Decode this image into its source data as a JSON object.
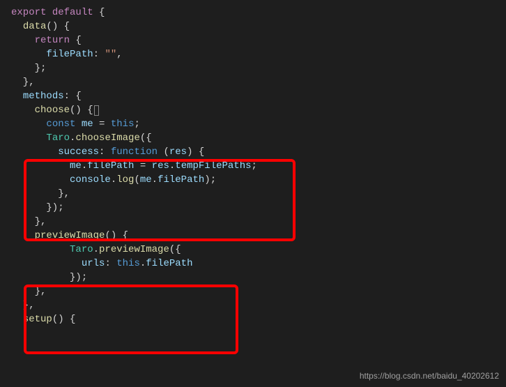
{
  "code": {
    "l1_export": "export",
    "l1_default": "default",
    "l1_brace": " {",
    "l2_data": "data",
    "l2_rest": "() {",
    "l3_return": "return",
    "l3_brace": " {",
    "l4_prop": "filePath",
    "l4_colon": ": ",
    "l4_str": "\"\"",
    "l4_comma": ",",
    "l5": "    };",
    "l6": "  },",
    "l7_methods": "methods",
    "l7_rest": ": {",
    "l8_choose": "choose",
    "l8_rest": "() ",
    "l8_brace": "{",
    "l9_const": "const",
    "l9_me": " me",
    "l9_eq": " = ",
    "l9_this": "this",
    "l9_semi": ";",
    "l10_taro": "Taro",
    "l10_dot": ".",
    "l10_fn": "chooseImage",
    "l10_rest": "({",
    "l11_success": "success",
    "l11_colon": ": ",
    "l11_function": "function",
    "l11_open": " (",
    "l11_res": "res",
    "l11_close": ") {",
    "l12_me": "me",
    "l12_d1": ".",
    "l12_fp": "filePath",
    "l12_eq": " = ",
    "l12_res": "res",
    "l12_d2": ".",
    "l12_tfp": "tempFilePaths",
    "l12_semi": ";",
    "l13_console": "console",
    "l13_d1": ".",
    "l13_log": "log",
    "l13_open": "(",
    "l13_me": "me",
    "l13_d2": ".",
    "l13_fp": "filePath",
    "l13_close": ");",
    "l14": "        },",
    "l15": "      });",
    "l16": "    },",
    "l17_preview": "previewImage",
    "l17_rest": "() {",
    "l18_taro": "Taro",
    "l18_dot": ".",
    "l18_fn": "previewImage",
    "l18_rest": "({",
    "l19_urls": "urls",
    "l19_colon": ": ",
    "l19_this": "this",
    "l19_dot": ".",
    "l19_fp": "filePath",
    "l20": "          });",
    "l21": "    },",
    "l22": "  },",
    "l23_setup": "setup",
    "l23_rest": "() {"
  },
  "watermark": "https://blog.csdn.net/baidu_40202612"
}
